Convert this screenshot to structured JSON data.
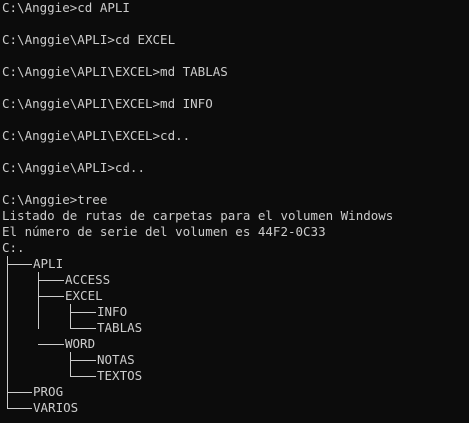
{
  "colors": {
    "background": "#0c0c0c",
    "foreground": "#cccccc"
  },
  "console_lines": [
    "C:\\Anggie>cd APLI",
    "",
    "C:\\Anggie\\APLI>cd EXCEL",
    "",
    "C:\\Anggie\\APLI\\EXCEL>md TABLAS",
    "",
    "C:\\Anggie\\APLI\\EXCEL>md INFO",
    "",
    "C:\\Anggie\\APLI\\EXCEL>cd..",
    "",
    "C:\\Anggie\\APLI>cd..",
    "",
    "C:\\Anggie>tree",
    "Listado de rutas de carpetas para el volumen Windows",
    "El número de serie del volumen es 44F2-0C33",
    "C:."
  ],
  "tree": {
    "root": "C:.",
    "nodes": [
      {
        "label": "APLI"
      },
      {
        "label": "ACCESS"
      },
      {
        "label": "EXCEL"
      },
      {
        "label": "INFO"
      },
      {
        "label": "TABLAS"
      },
      {
        "label": "WORD"
      },
      {
        "label": "NOTAS"
      },
      {
        "label": "TEXTOS"
      },
      {
        "label": "PROG"
      },
      {
        "label": "VARIOS"
      }
    ]
  }
}
